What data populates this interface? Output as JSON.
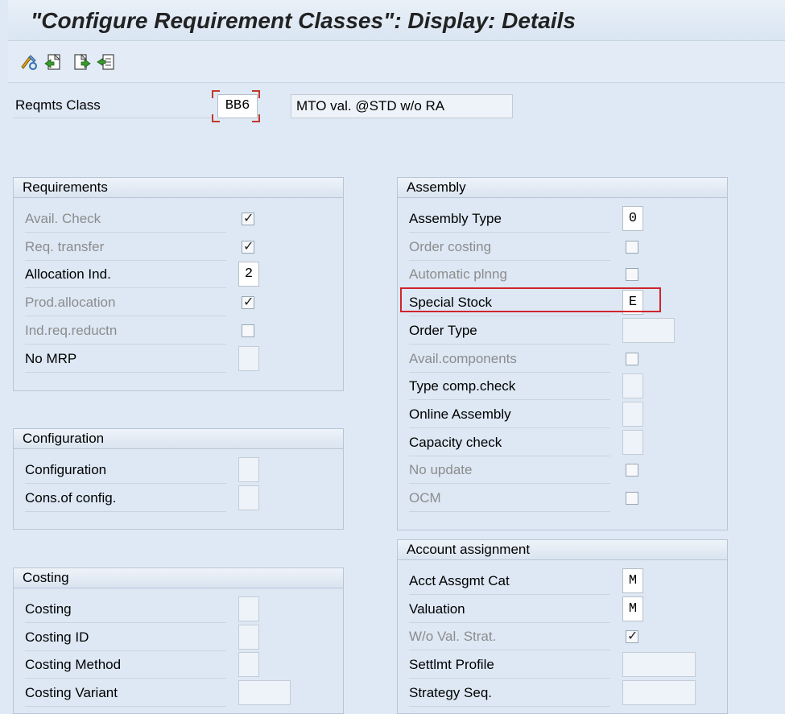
{
  "title": "\"Configure Requirement Classes\": Display: Details",
  "toolbar": {
    "icons": [
      "display-change-icon",
      "previous-entry-icon",
      "next-entry-icon",
      "other-entry-icon"
    ]
  },
  "header": {
    "reqmts_class_label": "Reqmts Class",
    "reqmts_class_value": "BB6",
    "description": "MTO val. @STD w/o RA"
  },
  "requirements": {
    "title": "Requirements",
    "rows": [
      {
        "label": "Avail. Check",
        "type": "check",
        "checked": true,
        "readonly": true
      },
      {
        "label": "Req. transfer",
        "type": "check",
        "checked": true,
        "readonly": true
      },
      {
        "label": "Allocation Ind.",
        "type": "field",
        "value": "2",
        "readonly": false
      },
      {
        "label": "Prod.allocation",
        "type": "check",
        "checked": true,
        "readonly": true
      },
      {
        "label": "Ind.req.reductn",
        "type": "check",
        "checked": false,
        "readonly": true
      },
      {
        "label": "No MRP",
        "type": "field",
        "value": "",
        "readonly": false
      }
    ]
  },
  "configuration": {
    "title": "Configuration",
    "rows": [
      {
        "label": "Configuration",
        "value": ""
      },
      {
        "label": "Cons.of config.",
        "value": ""
      }
    ]
  },
  "costing": {
    "title": "Costing",
    "rows": [
      {
        "label": "Costing",
        "value": ""
      },
      {
        "label": "Costing ID",
        "value": ""
      },
      {
        "label": "Costing Method",
        "value": ""
      },
      {
        "label": "Costing Variant",
        "value": ""
      }
    ]
  },
  "assembly": {
    "title": "Assembly",
    "rows": [
      {
        "label": "Assembly Type",
        "type": "field",
        "value": "0",
        "readonly": false
      },
      {
        "label": "Order costing",
        "type": "check",
        "checked": false,
        "readonly": true
      },
      {
        "label": "Automatic plnng",
        "type": "check",
        "checked": false,
        "readonly": true
      },
      {
        "label": "Special Stock",
        "type": "field",
        "value": "E",
        "readonly": false
      },
      {
        "label": "Order Type",
        "type": "field",
        "value": "",
        "readonly": false
      },
      {
        "label": "Avail.components",
        "type": "check",
        "checked": false,
        "readonly": true
      },
      {
        "label": "Type comp.check",
        "type": "field",
        "value": "",
        "readonly": false
      },
      {
        "label": "Online Assembly",
        "type": "field",
        "value": "",
        "readonly": false
      },
      {
        "label": "Capacity check",
        "type": "field",
        "value": "",
        "readonly": false
      },
      {
        "label": "No update",
        "type": "check",
        "checked": false,
        "readonly": true
      },
      {
        "label": "OCM",
        "type": "check",
        "checked": false,
        "readonly": true
      }
    ]
  },
  "account_assignment": {
    "title": "Account assignment",
    "rows": [
      {
        "label": "Acct Assgmt Cat",
        "type": "field",
        "value": "M",
        "readonly": false
      },
      {
        "label": "Valuation",
        "type": "field",
        "value": "M",
        "readonly": false
      },
      {
        "label": "W/o Val. Strat.",
        "type": "check",
        "checked": true,
        "readonly": true
      },
      {
        "label": "Settlmt Profile",
        "type": "field",
        "value": "",
        "readonly": false
      },
      {
        "label": "Strategy Seq.",
        "type": "field",
        "value": "",
        "readonly": false
      }
    ]
  },
  "colors": {
    "background": "#dfe9f5",
    "highlight": "#d0252b",
    "readonly_text": "#8c8c8c"
  }
}
